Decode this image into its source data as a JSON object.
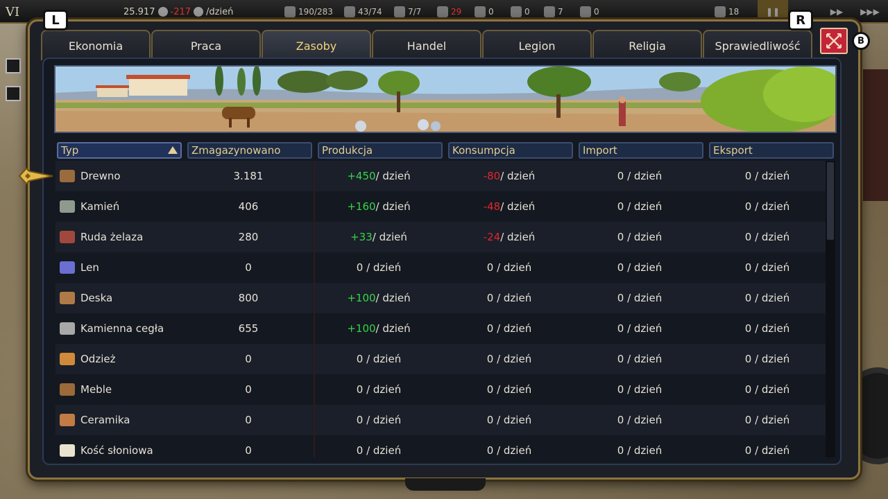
{
  "topbar": {
    "level": "VI",
    "gold": "25.917",
    "gold_rate": "-217",
    "gold_rate_unit": "/dzień",
    "population": "190/283",
    "stat2": "43/74",
    "stat3": "7/7",
    "stat4": "29",
    "stat5": "0",
    "stat6": "0",
    "stat7": "7",
    "stat8": "0",
    "stat9": "18"
  },
  "hints": {
    "left": "L",
    "right": "R",
    "back": "B"
  },
  "tabs": [
    {
      "label": "Ekonomia",
      "active": false
    },
    {
      "label": "Praca",
      "active": false
    },
    {
      "label": "Zasoby",
      "active": true
    },
    {
      "label": "Handel",
      "active": false
    },
    {
      "label": "Legion",
      "active": false
    },
    {
      "label": "Religia",
      "active": false
    },
    {
      "label": "Sprawiedliwość",
      "active": false
    }
  ],
  "table": {
    "headers": {
      "type": "Typ",
      "stored": "Zmagazynowano",
      "production": "Produkcja",
      "consumption": "Konsumpcja",
      "import": "Import",
      "export": "Eksport"
    },
    "unit": " / dzień",
    "rows": [
      {
        "name": "Drewno",
        "stored": "3.181",
        "prod": "+450",
        "cons": "-80",
        "imp": "0 / dzień",
        "exp": "0 / dzień",
        "icon": "log-icon",
        "icon_color": "#9a6b3f"
      },
      {
        "name": "Kamień",
        "stored": "406",
        "prod": "+160",
        "cons": "-48",
        "imp": "0 / dzień",
        "exp": "0 / dzień",
        "icon": "stone-icon",
        "icon_color": "#8e9a8e"
      },
      {
        "name": "Ruda żelaza",
        "stored": "280",
        "prod": "+33",
        "cons": "-24",
        "imp": "0 / dzień",
        "exp": "0 / dzień",
        "icon": "iron-ore-icon",
        "icon_color": "#a1483e"
      },
      {
        "name": "Len",
        "stored": "0",
        "prod": "0 / dzień",
        "cons": "0 / dzień",
        "imp": "0 / dzień",
        "exp": "0 / dzień",
        "icon": "flax-icon",
        "icon_color": "#6a6fd0"
      },
      {
        "name": "Deska",
        "stored": "800",
        "prod": "+100",
        "cons": "0 / dzień",
        "imp": "0 / dzień",
        "exp": "0 / dzień",
        "icon": "plank-icon",
        "icon_color": "#b07a48"
      },
      {
        "name": "Kamienna cegła",
        "stored": "655",
        "prod": "+100",
        "cons": "0 / dzień",
        "imp": "0 / dzień",
        "exp": "0 / dzień",
        "icon": "brick-icon",
        "icon_color": "#a8a8a8"
      },
      {
        "name": "Odzież",
        "stored": "0",
        "prod": "0 / dzień",
        "cons": "0 / dzień",
        "imp": "0 / dzień",
        "exp": "0 / dzień",
        "icon": "clothing-icon",
        "icon_color": "#d08a3a"
      },
      {
        "name": "Meble",
        "stored": "0",
        "prod": "0 / dzień",
        "cons": "0 / dzień",
        "imp": "0 / dzień",
        "exp": "0 / dzień",
        "icon": "furniture-icon",
        "icon_color": "#9a6a3a"
      },
      {
        "name": "Ceramika",
        "stored": "0",
        "prod": "0 / dzień",
        "cons": "0 / dzień",
        "imp": "0 / dzień",
        "exp": "0 / dzień",
        "icon": "pottery-icon",
        "icon_color": "#c27b45"
      },
      {
        "name": "Kość słoniowa",
        "stored": "0",
        "prod": "0 / dzień",
        "cons": "0 / dzień",
        "imp": "0 / dzień",
        "exp": "0 / dzień",
        "icon": "ivory-icon",
        "icon_color": "#e8e2cf"
      }
    ]
  },
  "colors": {
    "accent_gold": "#e3ce94",
    "positive": "#39d449",
    "negative": "#e4262e",
    "close_red": "#c3243a"
  }
}
